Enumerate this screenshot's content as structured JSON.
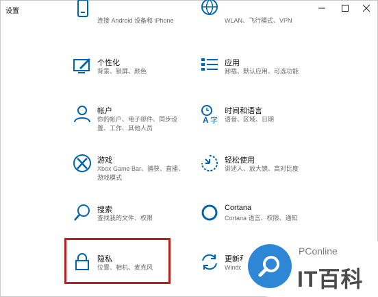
{
  "window": {
    "title": "设置",
    "minimize_icon": "minimize-icon",
    "maximize_icon": "maximize-icon",
    "close_icon": "close-icon"
  },
  "tiles": {
    "phone": {
      "name": "",
      "desc": "连接 Android 设备和 iPhone",
      "icon": "phone-icon"
    },
    "network": {
      "name": "",
      "desc": "WLAN、飞行模式、VPN",
      "icon": "globe-icon"
    },
    "personalization": {
      "name": "个性化",
      "desc": "背景、锁屏、颜色",
      "icon": "personalization-icon"
    },
    "apps": {
      "name": "应用",
      "desc": "卸载、默认应用、可选功能",
      "icon": "apps-list-icon"
    },
    "accounts": {
      "name": "帐户",
      "desc": "你的帐户、电子邮件、同步设置、工作、其他人员",
      "icon": "person-icon"
    },
    "time": {
      "name": "时间和语言",
      "desc": "语音、区域、日期",
      "icon": "time-language-icon"
    },
    "gaming": {
      "name": "游戏",
      "desc": "Xbox Game Bar、捕获、直播、游戏模式",
      "icon": "xbox-icon"
    },
    "ease": {
      "name": "轻松使用",
      "desc": "讲述人、放大镜、高对比度",
      "icon": "ease-of-access-icon"
    },
    "search": {
      "name": "搜索",
      "desc": "查找我的文件、权限",
      "icon": "search-icon"
    },
    "cortana": {
      "name": "Cortana",
      "desc": "Cortana 语言、权限、通知",
      "icon": "cortana-icon"
    },
    "privacy": {
      "name": "隐私",
      "desc": "位置、相机、麦克风",
      "icon": "lock-icon"
    },
    "update": {
      "name": "更新和",
      "desc": "Windo",
      "icon": "refresh-icon"
    }
  },
  "watermark": {
    "brand": "PConline",
    "logo_text": "IT百科",
    "logo_icon": "magnifier-logo-icon"
  },
  "colors": {
    "accent": "#0063b1",
    "highlight": "#b7221f",
    "watermark_blue": "#2e86d6"
  }
}
